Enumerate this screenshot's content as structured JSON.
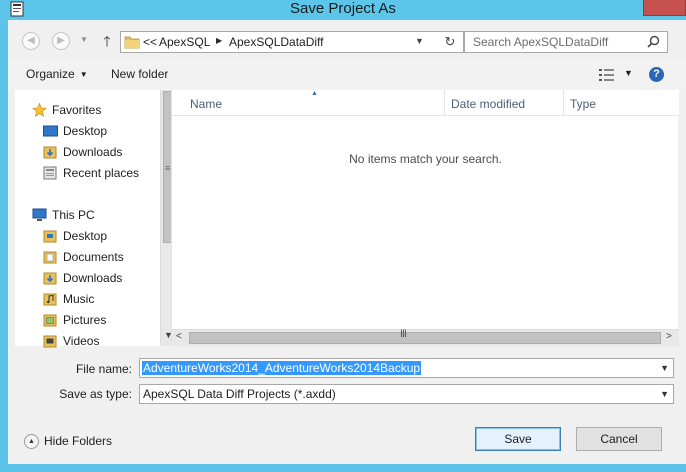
{
  "window": {
    "title": "Save Project As"
  },
  "address": {
    "overflow": "<<",
    "crumbs": [
      "ApexSQL",
      "ApexSQLDataDiff"
    ]
  },
  "search": {
    "placeholder": "Search ApexSQLDataDiff"
  },
  "toolbar": {
    "organize_label": "Organize",
    "new_folder_label": "New folder",
    "help_label": "?"
  },
  "nav": {
    "favorites": {
      "label": "Favorites",
      "items": [
        "Desktop",
        "Downloads",
        "Recent places"
      ]
    },
    "this_pc": {
      "label": "This PC",
      "items": [
        "Desktop",
        "Documents",
        "Downloads",
        "Music",
        "Pictures",
        "Videos"
      ]
    }
  },
  "file_list": {
    "columns": [
      "Name",
      "Date modified",
      "Type"
    ],
    "empty_message": "No items match your search."
  },
  "form": {
    "file_name_label": "File name:",
    "file_name_value": "AdventureWorks2014_AdventureWorks2014Backup",
    "save_as_type_label": "Save as type:",
    "save_as_type_value": "ApexSQL Data Diff Projects (*.axdd)"
  },
  "footer": {
    "hide_folders_label": "Hide Folders",
    "save_label": "Save",
    "cancel_label": "Cancel"
  },
  "colors": {
    "title_bar": "#5cc6ea",
    "close_button": "#c7514f",
    "selection": "#3399ff",
    "header_text": "#4c607a"
  }
}
